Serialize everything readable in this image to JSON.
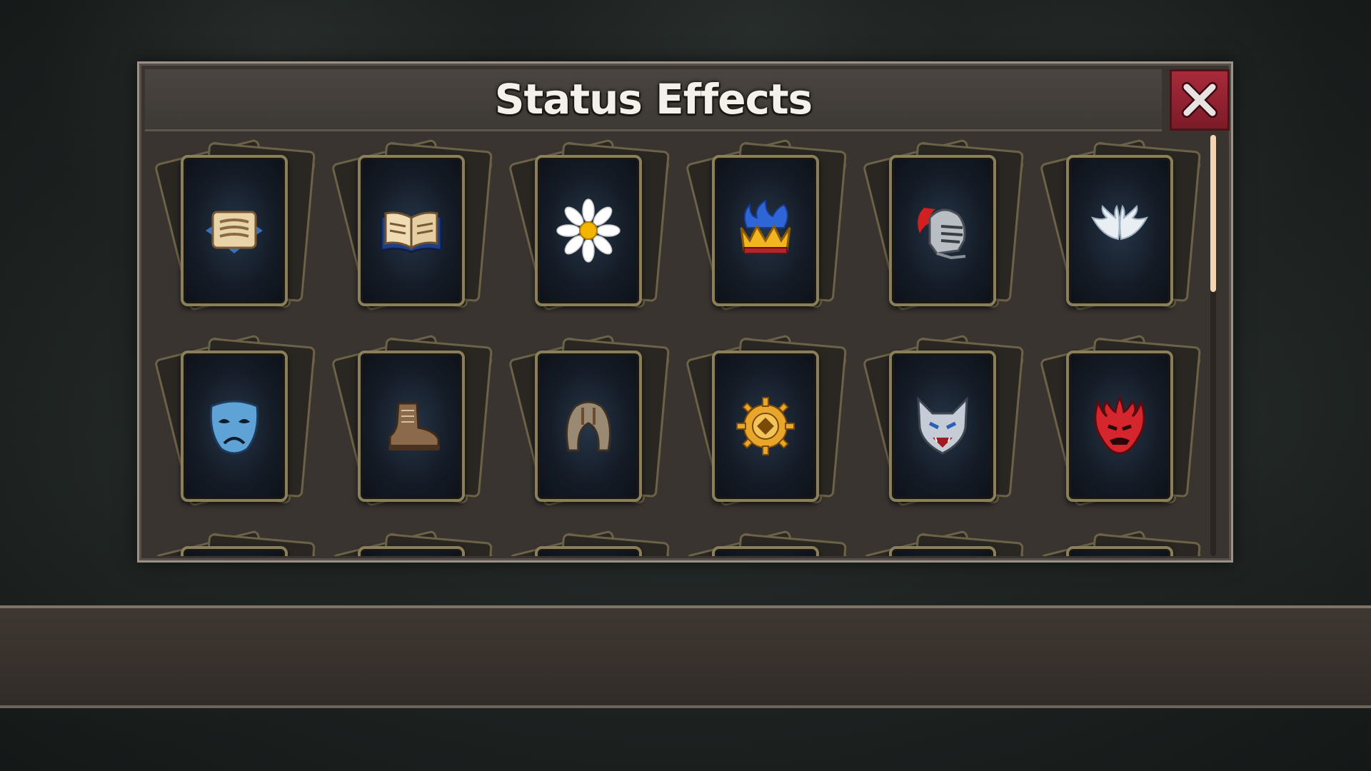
{
  "window": {
    "title": "Status Effects"
  },
  "colors": {
    "panel_bg": "#3a3431",
    "close_button": "#9b2434",
    "scroll_thumb": "#f3d7b1",
    "card_border": "#8a7f5b"
  },
  "status_effects": [
    {
      "row": 1,
      "icon": "scroll-icon"
    },
    {
      "row": 1,
      "icon": "open-book-icon"
    },
    {
      "row": 1,
      "icon": "daisy-flower-icon"
    },
    {
      "row": 1,
      "icon": "flaming-crown-icon"
    },
    {
      "row": 1,
      "icon": "knight-helmet-icon"
    },
    {
      "row": 1,
      "icon": "angel-wings-icon"
    },
    {
      "row": 2,
      "icon": "sad-mask-icon"
    },
    {
      "row": 2,
      "icon": "boot-icon"
    },
    {
      "row": 2,
      "icon": "hood-icon"
    },
    {
      "row": 2,
      "icon": "golden-gear-icon"
    },
    {
      "row": 2,
      "icon": "wolf-head-icon"
    },
    {
      "row": 2,
      "icon": "red-demon-icon"
    },
    {
      "row": 3,
      "icon": "hidden-card"
    },
    {
      "row": 3,
      "icon": "hidden-card"
    },
    {
      "row": 3,
      "icon": "hidden-card"
    },
    {
      "row": 3,
      "icon": "hidden-card"
    },
    {
      "row": 3,
      "icon": "hidden-card"
    },
    {
      "row": 3,
      "icon": "hidden-card"
    }
  ]
}
